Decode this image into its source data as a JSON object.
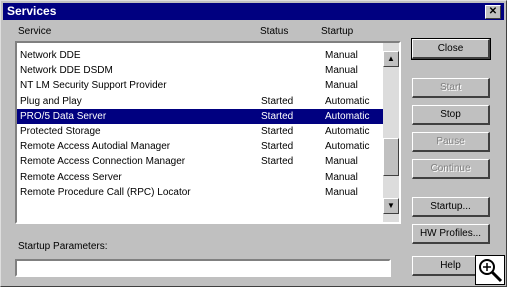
{
  "window": {
    "title": "Services",
    "close_glyph": "✕"
  },
  "columns": {
    "service": "Service",
    "status": "Status",
    "startup": "Startup"
  },
  "services": [
    {
      "name": "Network DDE",
      "status": "",
      "startup": "Manual"
    },
    {
      "name": "Network DDE DSDM",
      "status": "",
      "startup": "Manual"
    },
    {
      "name": "NT LM Security Support Provider",
      "status": "",
      "startup": "Manual"
    },
    {
      "name": "Plug and Play",
      "status": "Started",
      "startup": "Automatic"
    },
    {
      "name": "PRO/5 Data Server",
      "status": "Started",
      "startup": "Automatic",
      "selected": true
    },
    {
      "name": "Protected Storage",
      "status": "Started",
      "startup": "Automatic"
    },
    {
      "name": "Remote Access Autodial Manager",
      "status": "Started",
      "startup": "Automatic"
    },
    {
      "name": "Remote Access Connection Manager",
      "status": "Started",
      "startup": "Manual"
    },
    {
      "name": "Remote Access Server",
      "status": "",
      "startup": "Manual"
    },
    {
      "name": "Remote Procedure Call (RPC) Locator",
      "status": "",
      "startup": "Manual"
    }
  ],
  "buttons": {
    "close": "Close",
    "start": "Start",
    "stop": "Stop",
    "pause": "Pause",
    "continue": "Continue",
    "startup": "Startup...",
    "hw_profiles": "HW Profiles...",
    "help": "Help"
  },
  "startup_parameters": {
    "label": "Startup Parameters:",
    "value": ""
  },
  "colors": {
    "title_bar": "#000080",
    "face": "#c0c0c0",
    "selection": "#000080"
  },
  "icons": [
    "close-icon",
    "scroll-up-icon",
    "scroll-down-icon",
    "zoom-magnifier-icon"
  ]
}
